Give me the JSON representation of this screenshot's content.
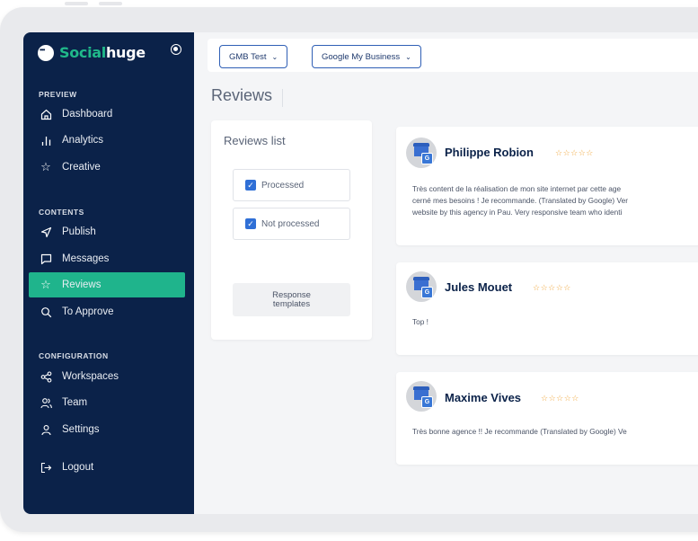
{
  "brand": {
    "name_part1": "Social",
    "name_part2": "huge",
    "accent": "#1fb48c",
    "sidebar_bg": "#0b2249"
  },
  "sidebar": {
    "sections": [
      {
        "title": "PREVIEW"
      },
      {
        "title": "CONTENTS"
      },
      {
        "title": "CONFIGURATION"
      }
    ],
    "items": [
      {
        "label": "Dashboard",
        "icon": "home-icon"
      },
      {
        "label": "Analytics",
        "icon": "bar-chart-icon"
      },
      {
        "label": "Creative",
        "icon": "star-icon"
      },
      {
        "label": "Publish",
        "icon": "send-icon"
      },
      {
        "label": "Messages",
        "icon": "message-icon"
      },
      {
        "label": "Reviews",
        "icon": "star-icon",
        "active": true
      },
      {
        "label": "To Approve",
        "icon": "search-icon"
      },
      {
        "label": "Workspaces",
        "icon": "share-icon"
      },
      {
        "label": "Team",
        "icon": "team-icon"
      },
      {
        "label": "Settings",
        "icon": "user-icon"
      },
      {
        "label": "Logout",
        "icon": "logout-icon"
      }
    ]
  },
  "topbar": {
    "workspace_select": "GMB Test",
    "platform_select": "Google My Business"
  },
  "page": {
    "title": "Reviews"
  },
  "reviews_list": {
    "title": "Reviews list",
    "filters": [
      {
        "label": "Processed",
        "checked": true
      },
      {
        "label": "Not processed",
        "checked": true
      }
    ],
    "templates_button": "Response templates"
  },
  "reviews": [
    {
      "author": "Philippe Robion",
      "stars": "☆☆☆☆☆",
      "lines": [
        "Très content de la réalisation de mon site internet par cette age",
        "cerné mes besoins ! Je recommande. (Translated by Google) Ver",
        "website by this agency in Pau. Very responsive team who identi"
      ]
    },
    {
      "author": "Jules Mouet",
      "stars": "☆☆☆☆☆",
      "lines": [
        "Top !"
      ]
    },
    {
      "author": "Maxime Vives",
      "stars": "☆☆☆☆☆",
      "lines": [
        "Très bonne agence !! Je recommande (Translated by Google) Ve"
      ]
    }
  ]
}
